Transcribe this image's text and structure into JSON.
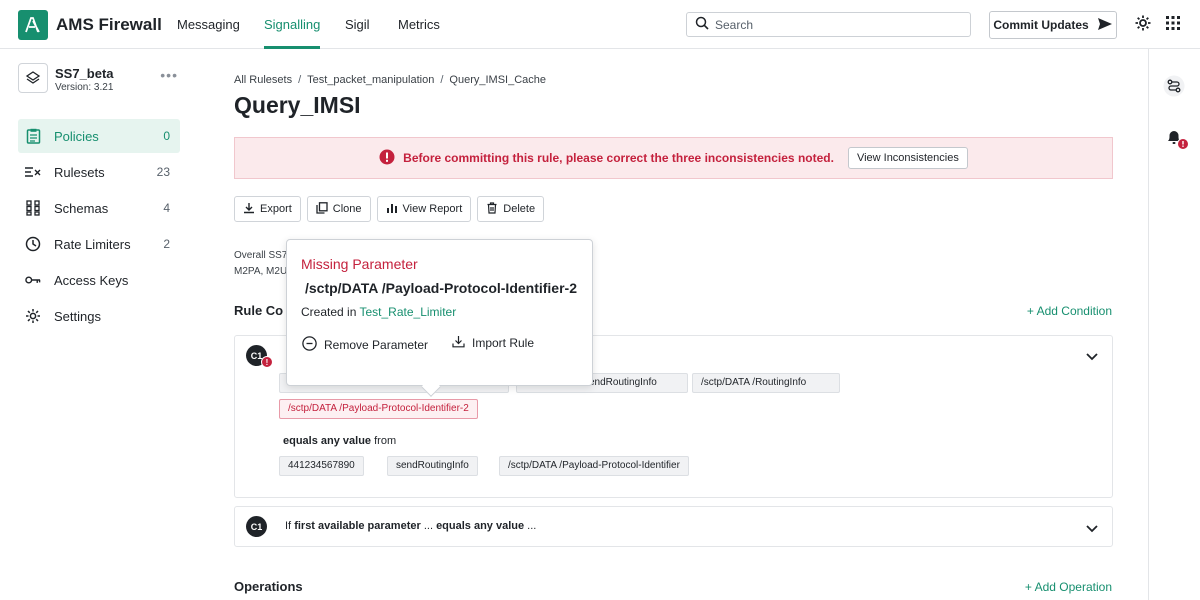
{
  "app": {
    "title": "AMS Firewall"
  },
  "nav": {
    "tabs": [
      {
        "label": "Messaging"
      },
      {
        "label": "Signalling"
      },
      {
        "label": "Sigil"
      },
      {
        "label": "Metrics"
      }
    ],
    "active_tab": "Signalling"
  },
  "search": {
    "placeholder": "Search"
  },
  "commit": {
    "label": "Commit Updates"
  },
  "project": {
    "name": "SS7_beta",
    "version": "Version: 3.21"
  },
  "sidebar": {
    "items": [
      {
        "label": "Policies",
        "count": "0",
        "icon": "clipboard-icon"
      },
      {
        "label": "Rulesets",
        "count": "23",
        "icon": "list-check-icon"
      },
      {
        "label": "Schemas",
        "count": "4",
        "icon": "grid-icon"
      },
      {
        "label": "Rate Limiters",
        "count": "2",
        "icon": "clock-icon"
      },
      {
        "label": "Access Keys",
        "count": "",
        "icon": "key-icon"
      },
      {
        "label": "Settings",
        "count": "",
        "icon": "gear-icon"
      }
    ]
  },
  "breadcrumb": {
    "items": [
      "All Rulesets",
      "Test_packet_manipulation",
      "Query_IMSI_Cache"
    ]
  },
  "page": {
    "title": "Query_IMSI"
  },
  "alert": {
    "message": "Before committing this rule, please correct the three inconsistencies noted.",
    "button": "View Inconsistencies"
  },
  "actions": {
    "export": "Export",
    "clone": "Clone",
    "view_report": "View Report",
    "delete": "Delete"
  },
  "overall": {
    "line1": "Overall SS7",
    "line2": "M2PA, M2U"
  },
  "rule_conditions": {
    "title": "Rule Co",
    "add_label": "+ Add Condition",
    "card1": {
      "badge": "C1",
      "error_mark": "!",
      "top_chips": [
        "endRoutingInfo",
        "/sctp/DATA /RoutingInfo"
      ],
      "error_chip": "/sctp/DATA /Payload-Protocol-Identifier-2",
      "equals_bold": "equals any value",
      "equals_rest": "from",
      "value_chips": [
        "441234567890",
        "sendRoutingInfo",
        "/sctp/DATA /Payload-Protocol-Identifier"
      ]
    },
    "card2": {
      "badge": "C1",
      "if": "If",
      "param": "first available parameter",
      "mid": "...",
      "equals": "equals any value",
      "tail": "..."
    }
  },
  "operations": {
    "title": "Operations",
    "add_label": "+ Add Operation"
  },
  "popover": {
    "title": "Missing Parameter",
    "path": "/sctp/DATA /Payload-Protocol-Identifier-2",
    "created_prefix": "Created in",
    "created_link": "Test_Rate_Limiter",
    "remove": "Remove Parameter",
    "import": "Import Rule"
  },
  "colors": {
    "accent": "#178f6f",
    "error": "#c4213d",
    "alert_bg": "#fbeaec"
  }
}
